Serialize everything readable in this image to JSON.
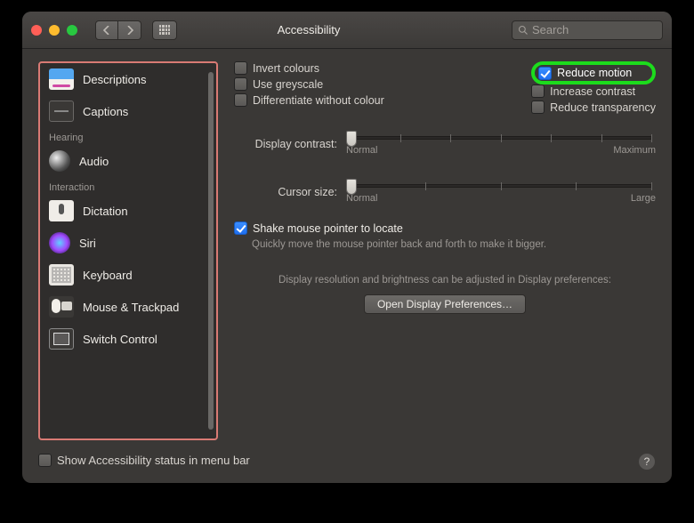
{
  "window": {
    "title": "Accessibility"
  },
  "search": {
    "placeholder": "Search"
  },
  "sidebar": {
    "items": [
      {
        "label": "Descriptions",
        "icon": "ic-descriptions"
      },
      {
        "label": "Captions",
        "icon": "ic-captions"
      }
    ],
    "section_hearing": "Hearing",
    "hearing_items": [
      {
        "label": "Audio",
        "icon": "ic-audio"
      }
    ],
    "section_interaction": "Interaction",
    "interaction_items": [
      {
        "label": "Dictation",
        "icon": "ic-dictation"
      },
      {
        "label": "Siri",
        "icon": "ic-siri"
      },
      {
        "label": "Keyboard",
        "icon": "ic-keyboard"
      },
      {
        "label": "Mouse & Trackpad",
        "icon": "ic-mouse"
      },
      {
        "label": "Switch Control",
        "icon": "ic-switch"
      }
    ]
  },
  "options": {
    "left": [
      {
        "label": "Invert colours",
        "checked": false
      },
      {
        "label": "Use greyscale",
        "checked": false
      },
      {
        "label": "Differentiate without colour",
        "checked": false
      }
    ],
    "right": [
      {
        "label": "Reduce motion",
        "checked": true,
        "highlight": true
      },
      {
        "label": "Increase contrast",
        "checked": false
      },
      {
        "label": "Reduce transparency",
        "checked": false
      }
    ]
  },
  "sliders": {
    "contrast": {
      "label": "Display contrast:",
      "min_label": "Normal",
      "max_label": "Maximum"
    },
    "cursor": {
      "label": "Cursor size:",
      "min_label": "Normal",
      "max_label": "Large"
    }
  },
  "shake": {
    "label": "Shake mouse pointer to locate",
    "checked": true,
    "desc": "Quickly move the mouse pointer back and forth to make it bigger."
  },
  "note": "Display resolution and brightness can be adjusted in Display preferences:",
  "open_button": "Open Display Preferences…",
  "footer": {
    "menubar_label": "Show Accessibility status in menu bar",
    "menubar_checked": false
  }
}
